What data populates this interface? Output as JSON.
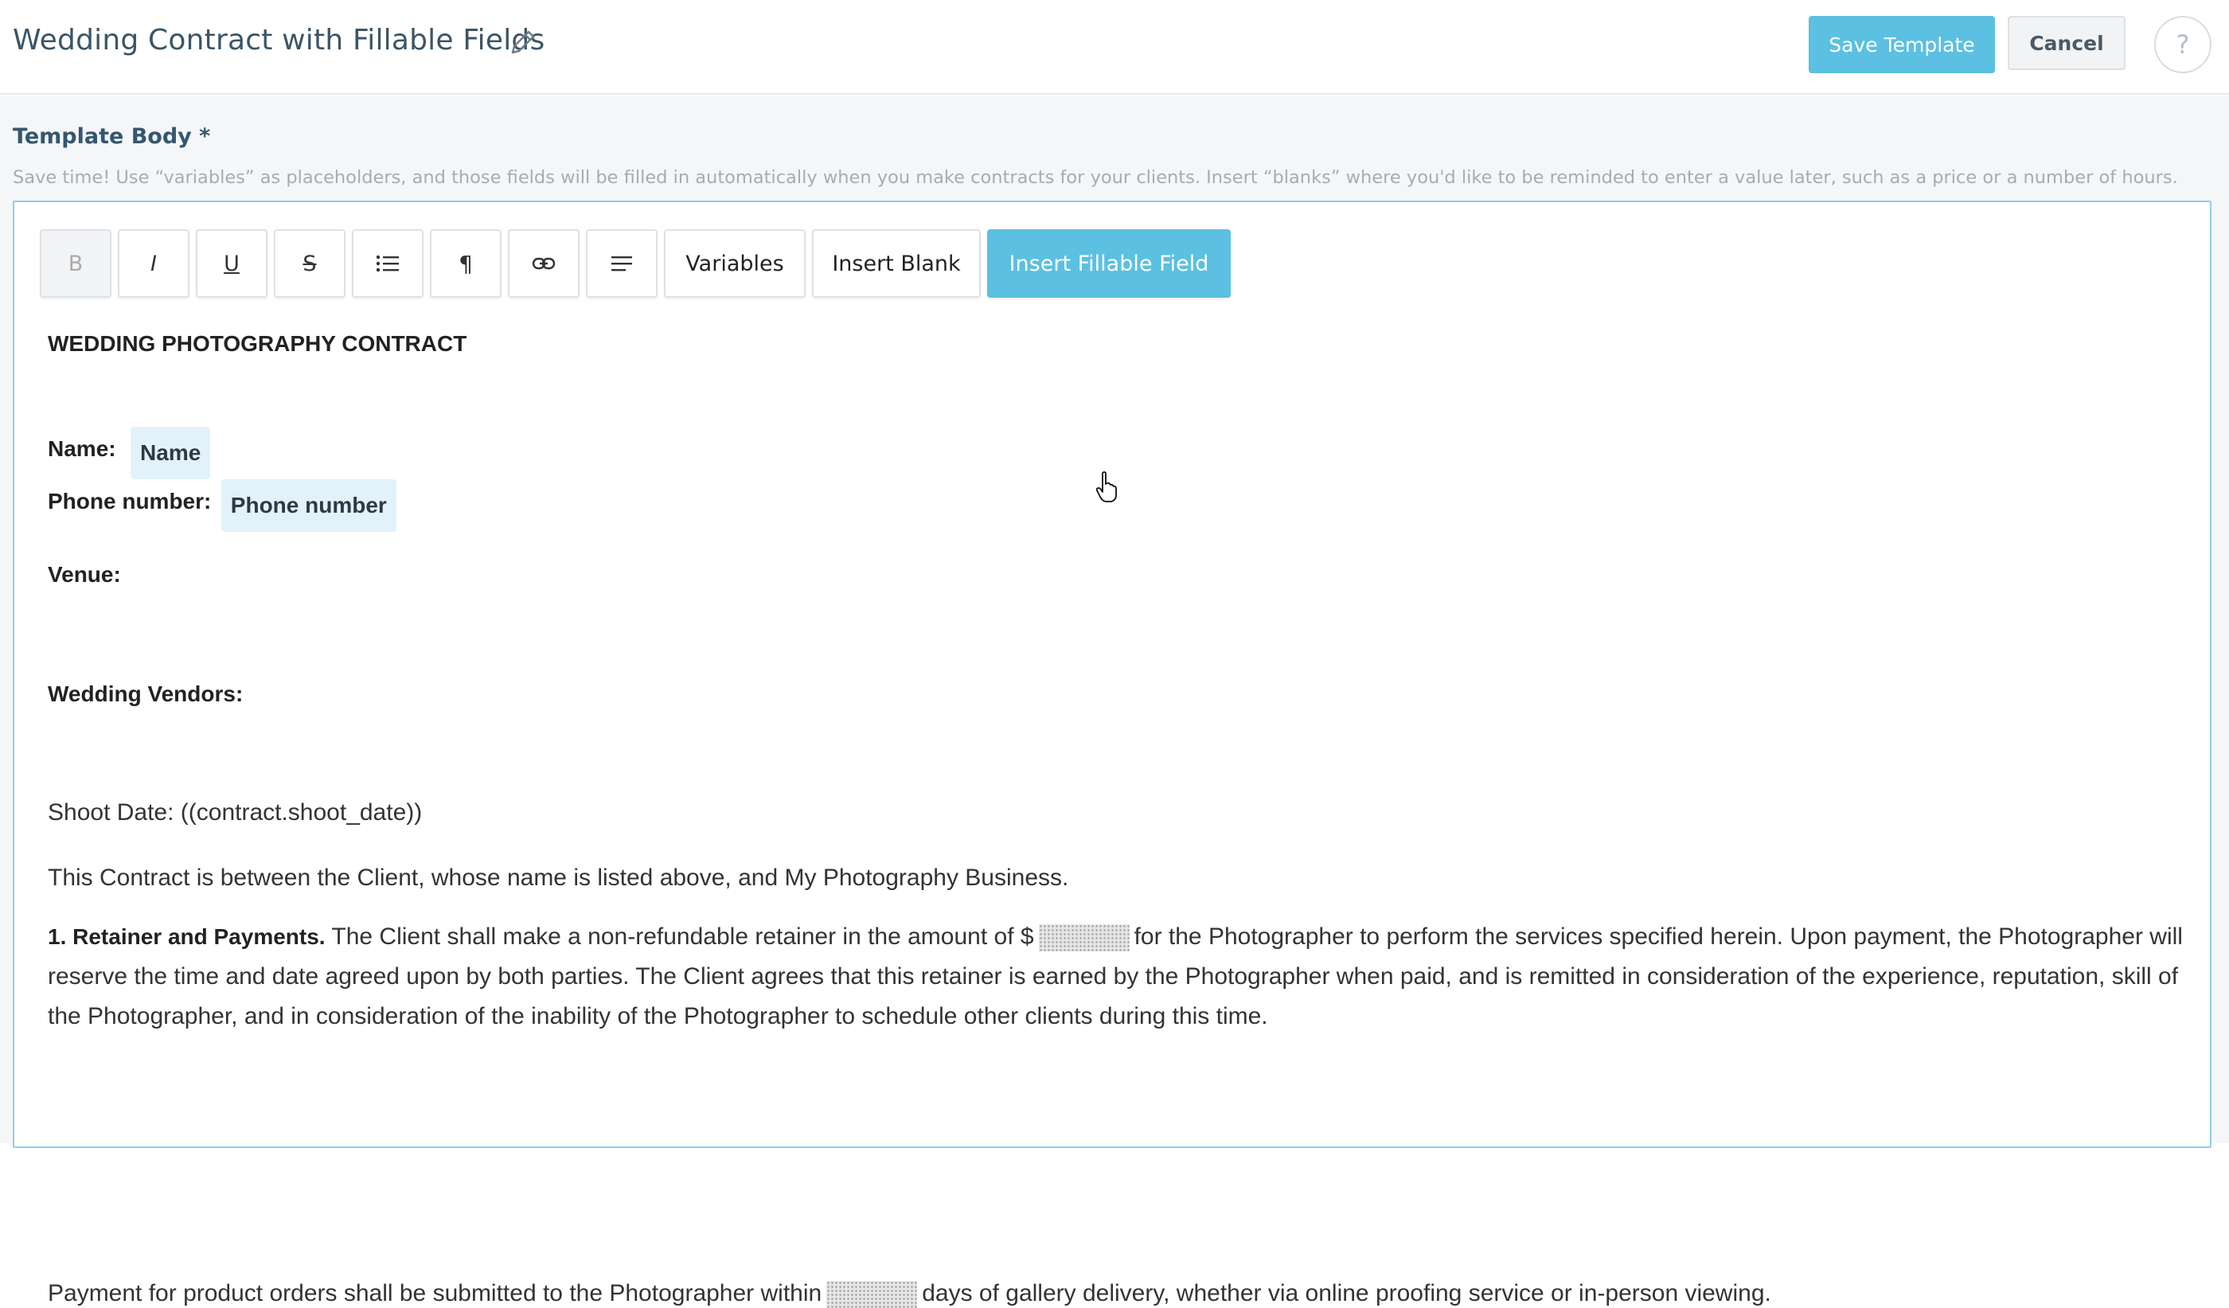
{
  "header": {
    "title": "Wedding Contract with Fillable Fields",
    "edit_icon": "pencil-icon",
    "save_label": "Save Template",
    "cancel_label": "Cancel",
    "help_label": "?"
  },
  "template": {
    "label": "Template Body *",
    "help_text": "Save time! Use “variables” as placeholders, and those fields will be filled in automatically when you make contracts for your clients. Insert “blanks” where you'd like to be reminded to enter a value later, such as a price or a number of hours."
  },
  "toolbar": {
    "bold": "B",
    "italic": "I",
    "underline": "U",
    "strike": "S",
    "paragraph": "¶",
    "variables": "Variables",
    "insert_blank": "Insert Blank",
    "insert_fillable": "Insert Fillable Field",
    "icons": [
      "bold-icon",
      "italic-icon",
      "underline-icon",
      "strikethrough-icon",
      "list-icon",
      "paragraph-icon",
      "link-icon",
      "align-icon"
    ]
  },
  "document": {
    "heading": "WEDDING PHOTOGRAPHY CONTRACT",
    "name_label": "Name:",
    "name_field": "Name",
    "phone_label": "Phone number:",
    "phone_field": "Phone number",
    "venue_label": "Venue:",
    "vendors_label": "Wedding Vendors:",
    "shoot_date": "Shoot Date: ((contract.shoot_date))",
    "intro": "This Contract is between the Client, whose name is listed above, and My Photography Business.",
    "section1_title": "1. Retainer and Payments.",
    "section1_a": "The Client shall make a non-refundable retainer in the amount of $",
    "section1_b": "for the Photographer to perform the services specified herein. Upon payment, the Photographer will",
    "section1_line2": "reserve the time and date agreed upon by both parties. The Client agrees that this retainer is earned by the Photographer when paid, and is remitted in consideration of the experience, reputation, skill of",
    "section1_line3": "the Photographer, and in consideration of the inability of the Photographer to schedule other clients during this time.",
    "payment_a": "Payment for product orders shall be submitted to the Photographer within",
    "payment_b": "days of gallery delivery, whether via online proofing service or in-person viewing."
  },
  "colors": {
    "accent": "#5bc0e1",
    "title": "#3b5566",
    "chip_bg": "#e3f2fa"
  }
}
